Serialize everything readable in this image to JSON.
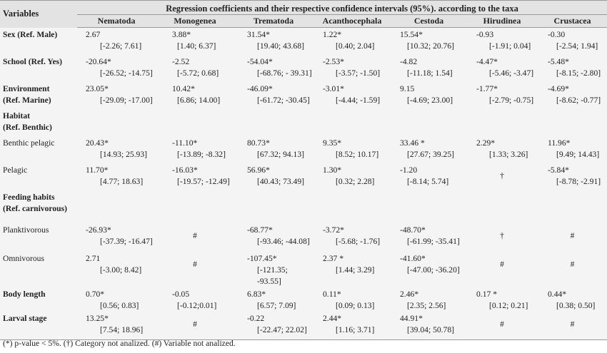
{
  "header": {
    "variables": "Variables",
    "group": "Regression coefficients and their respective confidence intervals (95%). according to the taxa",
    "taxa": [
      "Nematoda",
      "Monogenea",
      "Trematoda",
      "Acanthocephala",
      "Cestoda",
      "Hirudinea",
      "Crustacea"
    ]
  },
  "rows": [
    {
      "label": [
        "Sex (Ref. Male)"
      ],
      "bold": true,
      "cells": [
        [
          "2.67",
          "[-2.26; 7.61]"
        ],
        [
          "3.88*",
          "[1.40; 6.37]"
        ],
        [
          "31.54*",
          "[19.40; 43.68]"
        ],
        [
          "1.22*",
          "[0.40; 2.04]"
        ],
        [
          "15.54*",
          "[10.32; 20.76]"
        ],
        [
          "-0.93",
          "[-1.91; 0.04]"
        ],
        [
          "-0.30",
          "[-2.54; 1.94]"
        ]
      ]
    },
    {
      "label": [
        "School (Ref. Yes)"
      ],
      "bold": true,
      "cells": [
        [
          "-20.64*",
          "[-26.52; -14.75]"
        ],
        [
          "-2.52",
          "[-5.72; 0.68]"
        ],
        [
          "-54.04*",
          "[-68.76; - 39.31]"
        ],
        [
          "-2.53*",
          "[-3.57; -1.50]"
        ],
        [
          "-4.82",
          "[-11.18; 1.54]"
        ],
        [
          "-4.47*",
          "[-5.46; -3.47]"
        ],
        [
          "-5.48*",
          "[-8.15; -2.80]"
        ]
      ]
    },
    {
      "label": [
        "Environment",
        "(Ref. Marine)"
      ],
      "bold": true,
      "cells": [
        [
          "23.05*",
          "[-29.09; -17.00]"
        ],
        [
          "10.42*",
          "[6.86; 14.00]"
        ],
        [
          "-46.09*",
          "[-61.72; -30.45]"
        ],
        [
          "-3.01*",
          "[-4.44; -1.59]"
        ],
        [
          "9.15",
          "[-4.69; 23.00]"
        ],
        [
          "-1.77*",
          "[-2.79; -0.75]"
        ],
        [
          "-4.69*",
          "[-8.62; -0.77]"
        ]
      ]
    },
    {
      "label": [
        "Habitat",
        "(Ref. Benthic)"
      ],
      "bold": true,
      "cells": []
    },
    {
      "label": [
        "Benthic pelagic"
      ],
      "bold": false,
      "cells": [
        [
          "20.43*",
          "[14.93; 25.93]"
        ],
        [
          "-11.10*",
          "[-13.89; -8.32]"
        ],
        [
          "80.73*",
          "[67.32; 94.13]"
        ],
        [
          "9.35*",
          "[8.52; 10.17]"
        ],
        [
          "33.46 *",
          "[27.67; 39.25]"
        ],
        [
          "2.29*",
          "[1.33; 3.26]"
        ],
        [
          "11.96*",
          "[9.49; 14.43]"
        ]
      ]
    },
    {
      "label": [
        "Pelagic"
      ],
      "bold": false,
      "cells": [
        [
          "11.70*",
          "[4.77; 18.63]"
        ],
        [
          "-16.03*",
          "[-19.57; -12.49]"
        ],
        [
          "56.96*",
          "[40.43; 73.49]"
        ],
        [
          "1.30*",
          "[0.32; 2.28]"
        ],
        [
          "-1.20",
          "[-8.14; 5.74]"
        ],
        [
          "†"
        ],
        [
          "-5.84*",
          "[-8.78; -2.91]"
        ]
      ]
    },
    {
      "label": [
        "Feeding habits",
        "(Ref. carnivorous)"
      ],
      "bold": true,
      "cells": []
    },
    {
      "label": [
        "Planktivorous"
      ],
      "bold": false,
      "cells": [
        [
          "-26.93*",
          "[-37.39; -16.47]"
        ],
        [
          "#"
        ],
        [
          "-68.77*",
          "[-93.46; -44.08]"
        ],
        [
          "-3.72*",
          "[-5.68; -1.76]"
        ],
        [
          "-48.70*",
          "[-61.99; -35.41]"
        ],
        [
          "†"
        ],
        [
          "#"
        ]
      ]
    },
    {
      "label": [
        "Omnivorous"
      ],
      "bold": false,
      "cells": [
        [
          "2.71",
          "[-3.00; 8.42]"
        ],
        [
          "#"
        ],
        [
          "-107.45*",
          "[-121.35; -93.55]"
        ],
        [
          "2.37 *",
          "[1.44; 3.29]"
        ],
        [
          "-41.60*",
          "[-47.00; -36.20]"
        ],
        [
          "#"
        ],
        [
          "#"
        ]
      ]
    },
    {
      "label": [
        "Body length"
      ],
      "bold": true,
      "cells": [
        [
          "0.70*",
          "[0.56; 0.83]"
        ],
        [
          "-0.05",
          "[-0.12;0.01]"
        ],
        [
          "6.83*",
          "[6.57; 7.09]"
        ],
        [
          "0.11*",
          "[0.09; 0.13]"
        ],
        [
          "2.46*",
          "[2.35; 2.56]"
        ],
        [
          "0.17 *",
          "[0.12; 0.21]"
        ],
        [
          "0.44*",
          "[0.38; 0.50]"
        ]
      ]
    },
    {
      "label": [
        "Larval stage"
      ],
      "bold": true,
      "cells": [
        [
          "13.25*",
          "[7.54; 18.96]"
        ],
        [
          "#"
        ],
        [
          "-0.22",
          "[-22.47; 22.02]"
        ],
        [
          "2.44*",
          "[1.16; 3.71]"
        ],
        [
          "44.91*",
          "[39.04; 50.78]"
        ],
        [
          "#"
        ],
        [
          "#"
        ]
      ]
    }
  ],
  "footnote": "(*) p-value < 5%. (†) Category not analized. (#) Variable not analized."
}
